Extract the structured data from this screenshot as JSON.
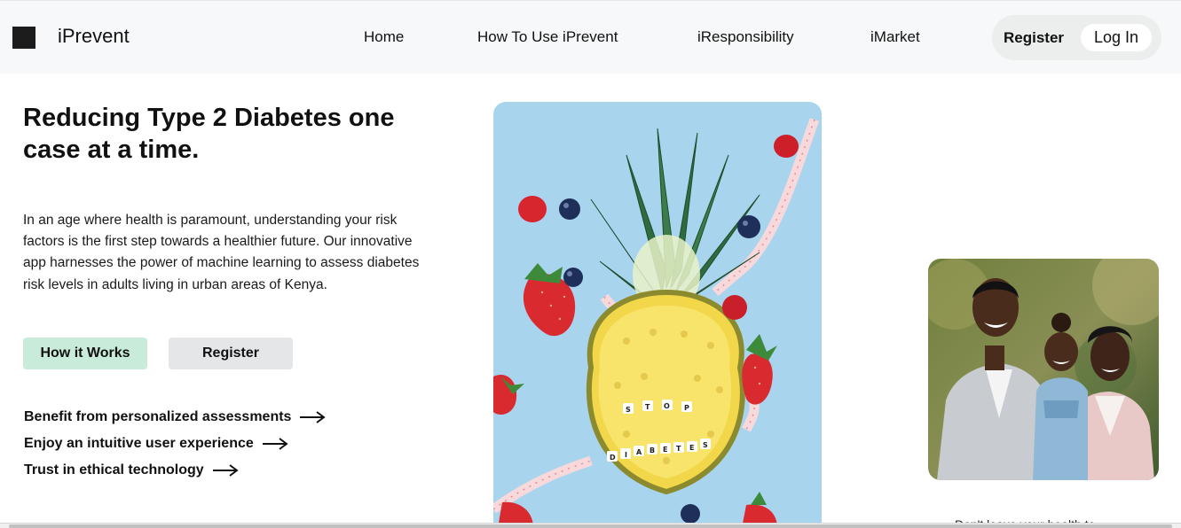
{
  "header": {
    "brand": "iPrevent",
    "nav": [
      "Home",
      "How To Use iPrevent",
      "iResponsibility",
      "iMarket"
    ],
    "register_label": "Register",
    "login_label": "Log In"
  },
  "hero": {
    "title": "Reducing Type 2 Diabetes one case at a time.",
    "description": "In an age where health is paramount, understanding your risk factors is the first step towards a healthier future. Our innovative app harnesses the power of machine learning to assess diabetes risk levels in adults living in urban areas of Kenya.",
    "how_it_works_label": "How it Works",
    "register_label": "Register",
    "benefits": [
      "Benefit from personalized assessments",
      "Enjoy an intuitive user experience",
      "Trust in ethical technology"
    ],
    "beads_top": [
      "S",
      "T",
      "O",
      "P"
    ],
    "beads_bottom": [
      "D",
      "I",
      "A",
      "B",
      "E",
      "T",
      "E",
      "S"
    ]
  },
  "right": {
    "bottom_text": "Don't leave your health to"
  },
  "colors": {
    "accent_green": "#c8ecd9",
    "header_bg": "#f7f8f9",
    "image_bg": "#a9d4ee"
  }
}
